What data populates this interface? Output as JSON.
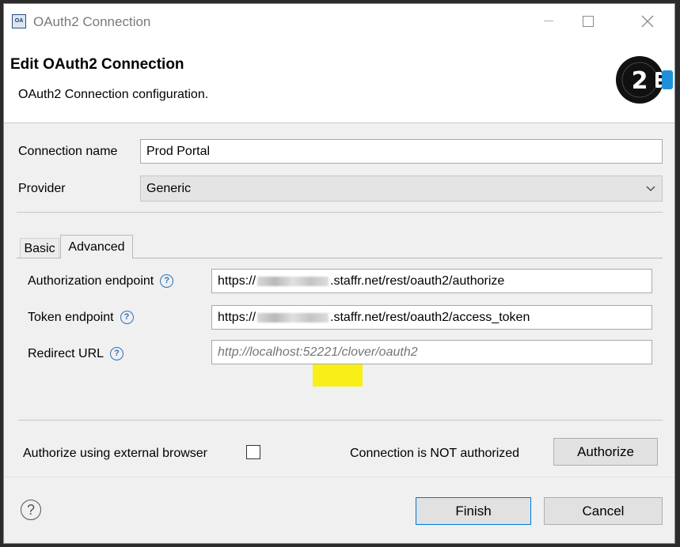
{
  "window": {
    "title": "OAuth2 Connection",
    "icon_text": "OA"
  },
  "header": {
    "title": "Edit OAuth2 Connection",
    "description": "OAuth2 Connection configuration.",
    "logo_icon": "oauth2-logo-icon"
  },
  "form": {
    "connection_name_label": "Connection name",
    "connection_name_value": "Prod Portal",
    "provider_label": "Provider",
    "provider_value": "Generic"
  },
  "tabs": [
    {
      "label": "Basic",
      "selected": false
    },
    {
      "label": "Advanced",
      "selected": true
    }
  ],
  "advanced": {
    "auth_endpoint_label": "Authorization endpoint",
    "auth_endpoint_prefix": "https://",
    "auth_endpoint_suffix": ".staffr.net/rest/oauth2/authorize",
    "token_endpoint_label": "Token endpoint",
    "token_endpoint_prefix": "https://",
    "token_endpoint_suffix": ".staffr.net/rest/oauth2/access_token",
    "redirect_url_label": "Redirect URL",
    "redirect_url_placeholder": "http://localhost:52221/clover/oauth2"
  },
  "auth": {
    "external_browser_label": "Authorize using external browser",
    "external_browser_checked": false,
    "status_text": "Connection is NOT authorized",
    "authorize_label": "Authorize"
  },
  "footer": {
    "help_glyph": "?",
    "finish_label": "Finish",
    "cancel_label": "Cancel"
  },
  "colors": {
    "highlight": "#f7ef17",
    "help_icon": "#2e6fba",
    "default_button_border": "#0078d7"
  }
}
